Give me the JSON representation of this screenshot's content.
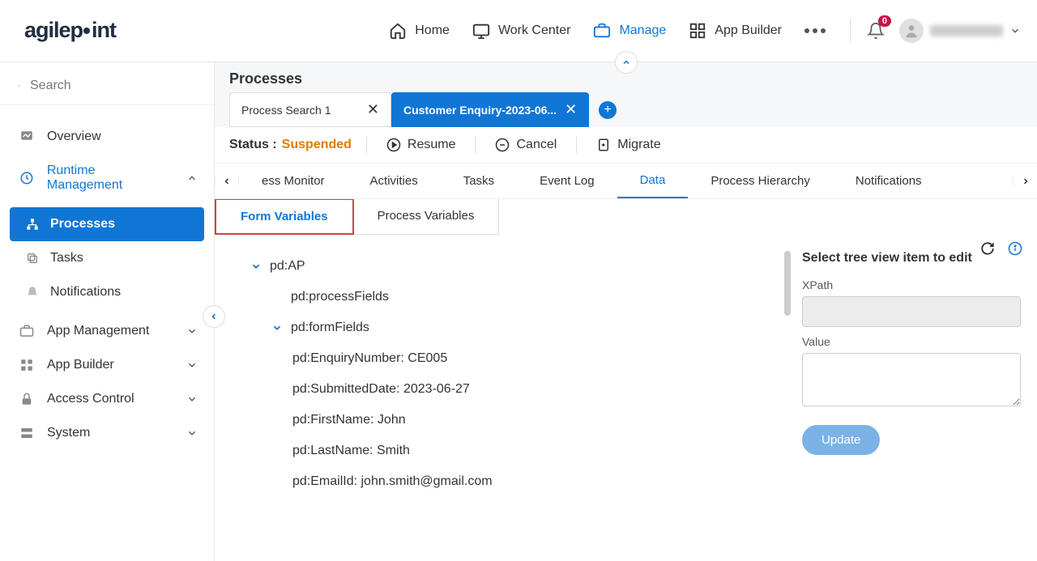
{
  "header": {
    "logo_text": "agilepoint",
    "nav": {
      "home": "Home",
      "work_center": "Work Center",
      "manage": "Manage",
      "app_builder": "App Builder"
    },
    "notification_count": "0"
  },
  "sidebar": {
    "search_placeholder": "Search",
    "items": {
      "overview": "Overview",
      "runtime": "Runtime Management",
      "processes": "Processes",
      "tasks": "Tasks",
      "notifications": "Notifications",
      "app_management": "App Management",
      "app_builder": "App Builder",
      "access_control": "Access Control",
      "system": "System"
    }
  },
  "main": {
    "title": "Processes",
    "tabs": [
      {
        "label": "Process Search 1",
        "active": false
      },
      {
        "label": "Customer Enquiry-2023-06...",
        "active": true
      }
    ],
    "status_label": "Status : ",
    "status_value": "Suspended",
    "actions": {
      "resume": "Resume",
      "cancel": "Cancel",
      "migrate": "Migrate"
    },
    "inner_tabs": [
      "ess Monitor",
      "Activities",
      "Tasks",
      "Event Log",
      "Data",
      "Process Hierarchy",
      "Notifications"
    ],
    "active_inner_tab": "Data",
    "sub_tabs": {
      "form_variables": "Form Variables",
      "process_variables": "Process Variables"
    },
    "tree": {
      "root": "pd:AP",
      "processFields": "pd:processFields",
      "formFields": "pd:formFields",
      "items": [
        "pd:EnquiryNumber: CE005",
        "pd:SubmittedDate: 2023-06-27",
        "pd:FirstName: John",
        "pd:LastName: Smith",
        "pd:EmailId: john.smith@gmail.com"
      ]
    },
    "detail": {
      "title": "Select tree view item to edit",
      "xpath_label": "XPath",
      "value_label": "Value",
      "update": "Update"
    }
  }
}
